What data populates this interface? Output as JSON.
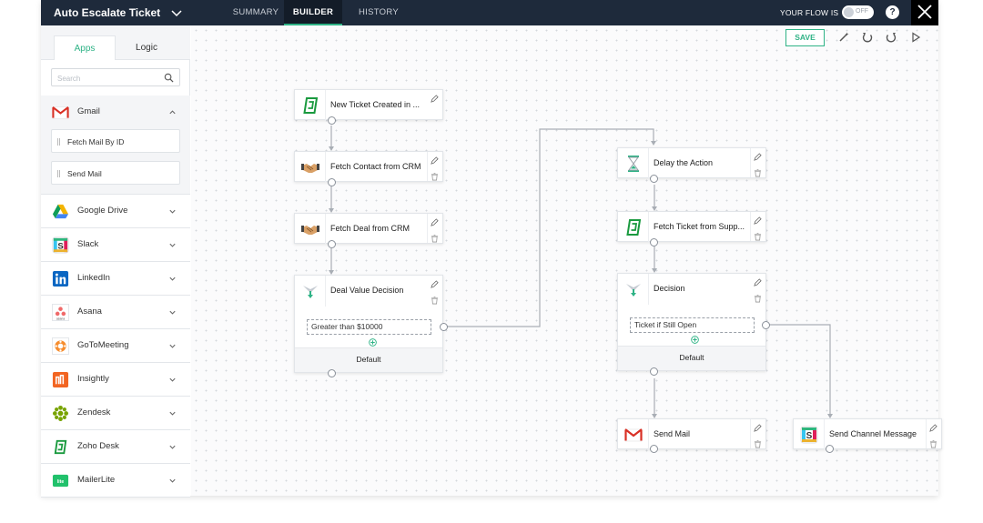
{
  "topbar": {
    "flow_title": "Auto Escalate Ticket",
    "tabs": [
      {
        "label": "SUMMARY"
      },
      {
        "label": "BUILDER"
      },
      {
        "label": "HISTORY"
      }
    ],
    "active_tab": "BUILDER",
    "flow_status_label": "YOUR FLOW IS",
    "toggle_state": "OFF",
    "help_label": "?"
  },
  "sidebar": {
    "tabs": [
      {
        "label": "Apps"
      },
      {
        "label": "Logic"
      }
    ],
    "active_tab": "Apps",
    "search_placeholder": "Search",
    "apps": [
      {
        "name": "Gmail",
        "icon": "gmail-icon"
      },
      {
        "name": "Google Drive",
        "icon": "google-drive-icon"
      },
      {
        "name": "Slack",
        "icon": "slack-icon"
      },
      {
        "name": "LinkedIn",
        "icon": "linkedin-icon"
      },
      {
        "name": "Asana",
        "icon": "asana-icon"
      },
      {
        "name": "GoToMeeting",
        "icon": "gotomeeting-icon"
      },
      {
        "name": "Insightly",
        "icon": "insightly-icon"
      },
      {
        "name": "Zendesk",
        "icon": "zendesk-icon"
      },
      {
        "name": "Zoho Desk",
        "icon": "zoho-desk-icon"
      },
      {
        "name": "MailerLite",
        "icon": "mailerlite-icon"
      }
    ],
    "gmail_actions": [
      {
        "label": "Fetch Mail By ID"
      },
      {
        "label": "Send Mail"
      }
    ]
  },
  "toolbar": {
    "save_label": "SAVE",
    "tools": [
      "magic-wand-icon",
      "undo-icon",
      "redo-icon",
      "run-icon"
    ]
  },
  "flow": {
    "left_branch": [
      {
        "label": "New Ticket Created in ...",
        "icon": "zoho-desk-icon"
      },
      {
        "label": "Fetch Contact from CRM",
        "icon": "crm-handshake-icon"
      },
      {
        "label": "Fetch Deal from CRM",
        "icon": "crm-handshake-icon"
      }
    ],
    "decision_1": {
      "label": "Deal Value Decision",
      "condition": "Greater than $10000",
      "default_label": "Default"
    },
    "right_branch": [
      {
        "label": "Delay the Action",
        "icon": "hourglass-icon"
      },
      {
        "label": "Fetch Ticket from Supp...",
        "icon": "zoho-desk-icon"
      }
    ],
    "decision_2": {
      "label": "Decision",
      "condition": "Ticket if Still Open",
      "default_label": "Default"
    },
    "outputs": [
      {
        "label": "Send Mail",
        "icon": "gmail-icon"
      },
      {
        "label": "Send Channel Message",
        "icon": "slack-icon"
      }
    ]
  },
  "colors": {
    "topbar_bg": "#1e2a3b",
    "accent": "#2fb386",
    "zoho_green": "#1a9a3f",
    "gmail_red": "#d93025"
  }
}
